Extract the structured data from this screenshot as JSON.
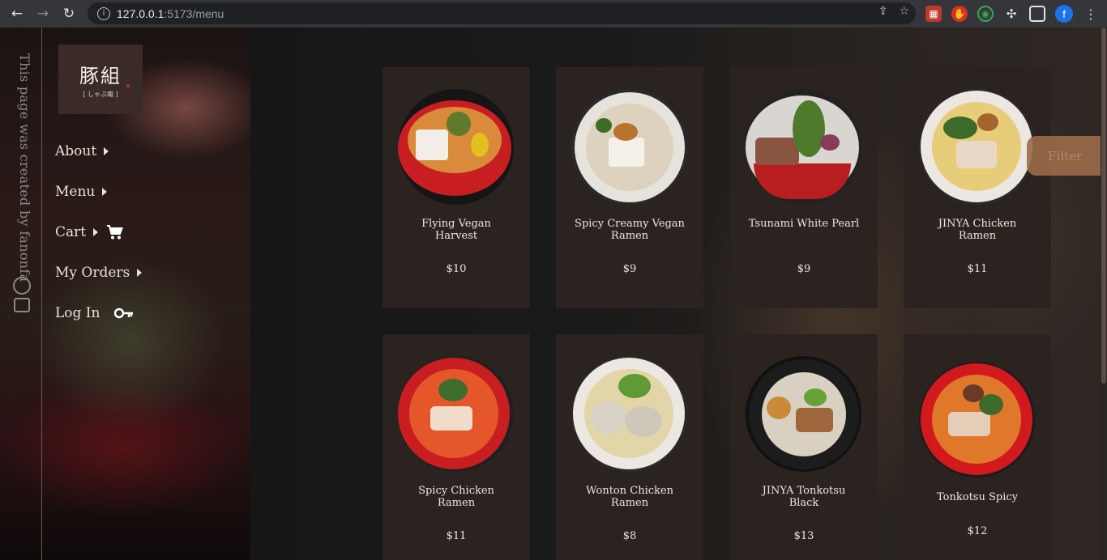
{
  "browser": {
    "url_host": "127.0.0.1",
    "url_path": ":5173/menu",
    "profile_initial": "f"
  },
  "sidebar": {
    "credit": "This page was created by fanonfa",
    "logo_mark": "豚組",
    "logo_sub": "[ しゃぶ庵 ]",
    "items": [
      {
        "label": "About",
        "icon": "caret-right-icon"
      },
      {
        "label": "Menu",
        "icon": "caret-right-icon"
      },
      {
        "label": "Cart",
        "icon": "cart-icon"
      },
      {
        "label": "My Orders",
        "icon": "caret-right-icon"
      },
      {
        "label": "Log In",
        "icon": "key-icon"
      }
    ]
  },
  "filter": {
    "label": "Filter"
  },
  "menu_items": [
    {
      "name": "Flying Vegan Harvest",
      "price": "$10",
      "bowl_color": "#c81e22"
    },
    {
      "name": "Spicy Creamy Vegan Ramen",
      "price": "$9",
      "bowl_color": "#e6e2dc"
    },
    {
      "name": "Tsunami White Pearl",
      "price": "$9",
      "bowl_color": "#d9d6d2"
    },
    {
      "name": "JINYA Chicken Ramen",
      "price": "$11",
      "bowl_color": "#ece8e1"
    },
    {
      "name": "Spicy Chicken Ramen",
      "price": "$11",
      "bowl_color": "#c81e22"
    },
    {
      "name": "Wonton Chicken Ramen",
      "price": "$8",
      "bowl_color": "#ece8e1"
    },
    {
      "name": "JINYA Tonkotsu Black",
      "price": "$13",
      "bowl_color": "#1c1c1c"
    },
    {
      "name": "Tonkotsu Spicy",
      "price": "$12",
      "bowl_color": "#d2191d"
    }
  ]
}
